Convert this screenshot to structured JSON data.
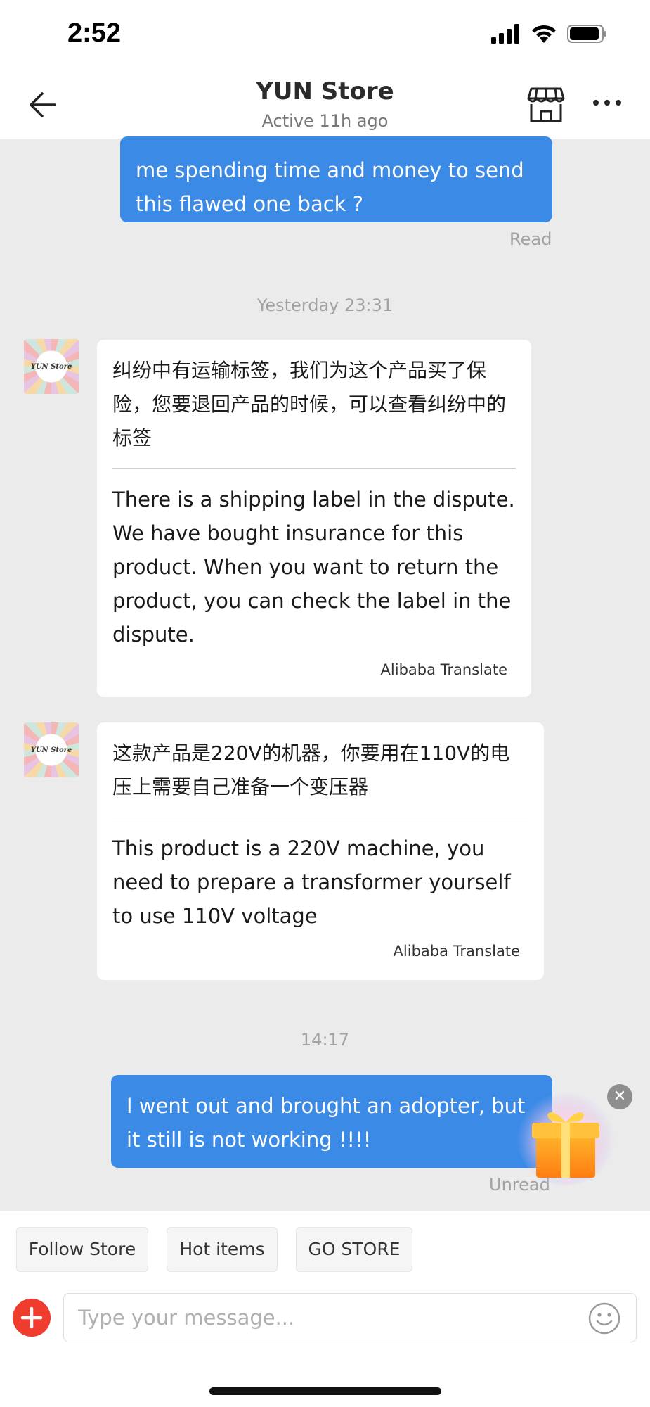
{
  "status": {
    "time": "2:52"
  },
  "header": {
    "title": "YUN Store",
    "subtitle": "Active 11h ago"
  },
  "messages": {
    "m1": {
      "text": "me spending time and money to send this flawed one back ?",
      "status": "Read"
    },
    "sep1": "Yesterday 23:31",
    "m2": {
      "avatar_label": "YUN Store",
      "original": "纠纷中有运输标签，我们为这个产品买了保险，您要退回产品的时候，可以查看纠纷中的标签",
      "translation": "There is a shipping label in the dispute. We have bought insurance for this product. When you want to return the product, you can check the label in the dispute.",
      "source": "Alibaba Translate"
    },
    "m3": {
      "avatar_label": "YUN Store",
      "original": "这款产品是220V的机器，你要用在110V的电压上需要自己准备一个变压器",
      "translation": "This product is a 220V machine, you need to prepare a transformer yourself to use 110V voltage",
      "source": "Alibaba Translate"
    },
    "sep2": "14:17",
    "m4": {
      "text": "I went out and brought an adopter, but it still is not working !!!!",
      "status": "Unread"
    }
  },
  "quick_replies": [
    "Follow Store",
    "Hot items",
    "GO STORE"
  ],
  "composer": {
    "placeholder": "Type your message..."
  },
  "colors": {
    "outgoing_bubble": "#3b8ae6",
    "chat_background": "#ebebeb",
    "add_button": "#ef3c2f"
  }
}
